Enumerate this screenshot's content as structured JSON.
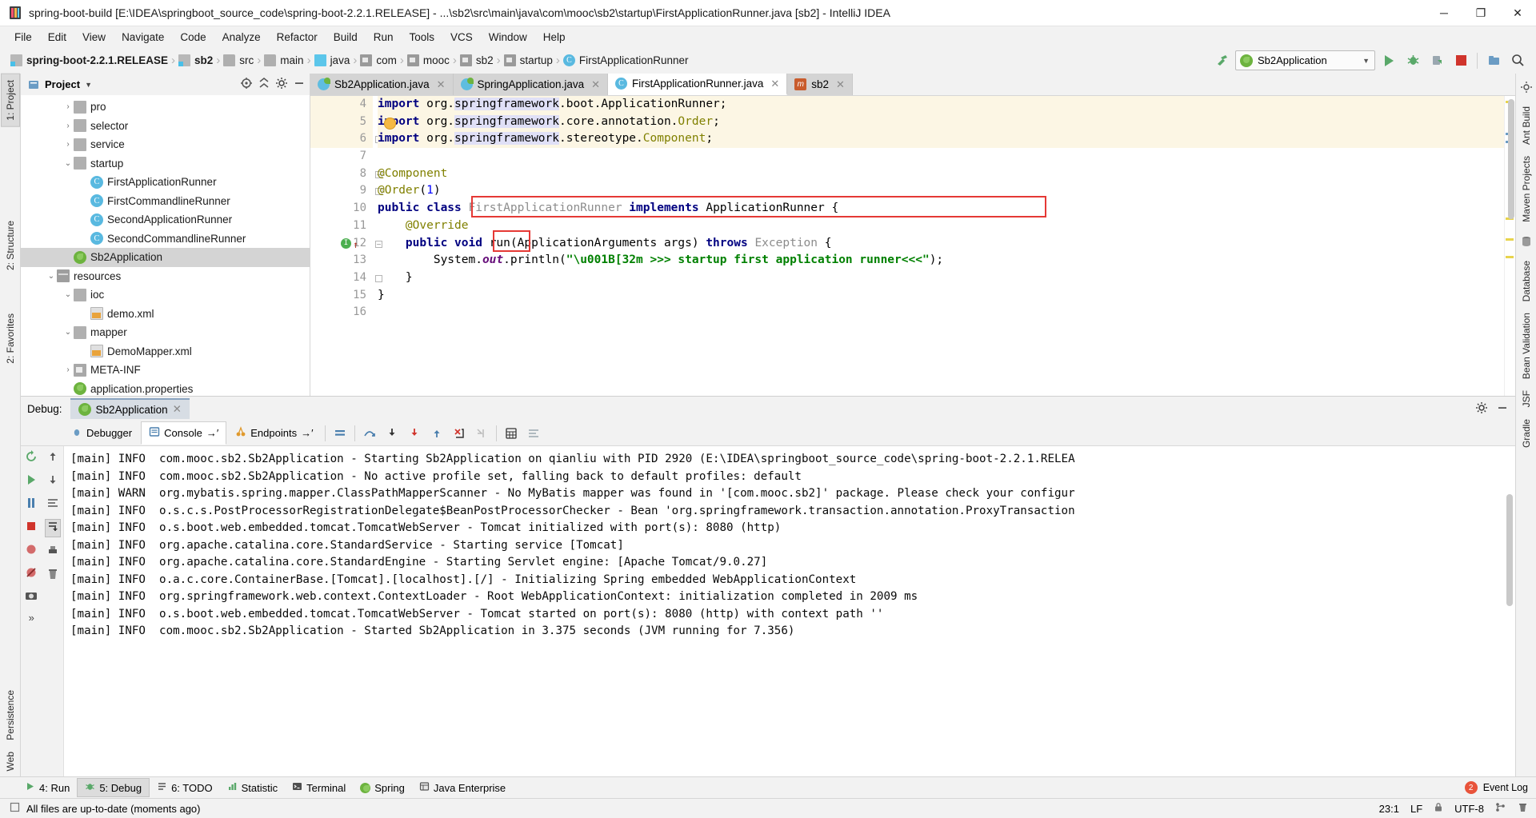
{
  "window": {
    "title": "spring-boot-build [E:\\IDEA\\springboot_source_code\\spring-boot-2.2.1.RELEASE] - ...\\sb2\\src\\main\\java\\com\\mooc\\sb2\\startup\\FirstApplicationRunner.java [sb2] - IntelliJ IDEA",
    "minimize": "─",
    "maximize": "❐",
    "close": "✕"
  },
  "menubar": [
    "File",
    "Edit",
    "View",
    "Navigate",
    "Code",
    "Analyze",
    "Refactor",
    "Build",
    "Run",
    "Tools",
    "VCS",
    "Window",
    "Help"
  ],
  "breadcrumbs": [
    {
      "label": "spring-boot-2.2.1.RELEASE",
      "icon": "module-root-icon",
      "bold": true
    },
    {
      "label": "sb2",
      "icon": "module-root-icon",
      "bold": true
    },
    {
      "label": "src",
      "icon": "folder-icon",
      "bold": false
    },
    {
      "label": "main",
      "icon": "folder-icon",
      "bold": false
    },
    {
      "label": "java",
      "icon": "source-folder-icon",
      "bold": false
    },
    {
      "label": "com",
      "icon": "package-icon",
      "bold": false
    },
    {
      "label": "mooc",
      "icon": "package-icon",
      "bold": false
    },
    {
      "label": "sb2",
      "icon": "package-icon",
      "bold": false
    },
    {
      "label": "startup",
      "icon": "package-icon",
      "bold": false
    },
    {
      "label": "FirstApplicationRunner",
      "icon": "class-icon",
      "bold": false
    }
  ],
  "toolbar": {
    "run_config": "Sb2Application",
    "run_title": "Run",
    "debug_title": "Debug",
    "coverage_title": "Run with Coverage",
    "stop_title": "Stop",
    "search_title": "Search Everywhere"
  },
  "left_rail": {
    "top_tab": "1: Project",
    "tabs": [
      "2: Structure",
      "2: Favorites",
      "Persistence",
      "Web"
    ]
  },
  "right_rail": {
    "tabs": [
      "Ant Build",
      "Maven Projects",
      "Database",
      "Bean Validation",
      "JSF",
      "Gradle"
    ]
  },
  "project_tool": {
    "title": "Project",
    "tree": [
      {
        "indent": 2,
        "arrow": "›",
        "icon": "folder-icon",
        "label": "pro",
        "selected": false
      },
      {
        "indent": 2,
        "arrow": "›",
        "icon": "folder-icon",
        "label": "selector",
        "selected": false
      },
      {
        "indent": 2,
        "arrow": "›",
        "icon": "folder-icon",
        "label": "service",
        "selected": false
      },
      {
        "indent": 2,
        "arrow": "⌄",
        "icon": "folder-icon",
        "label": "startup",
        "selected": false
      },
      {
        "indent": 3,
        "arrow": "",
        "icon": "class-icon",
        "label": "FirstApplicationRunner",
        "selected": false
      },
      {
        "indent": 3,
        "arrow": "",
        "icon": "spring-class-icon",
        "label": "FirstCommandlineRunner",
        "selected": false
      },
      {
        "indent": 3,
        "arrow": "",
        "icon": "spring-class-icon",
        "label": "SecondApplicationRunner",
        "selected": false
      },
      {
        "indent": 3,
        "arrow": "",
        "icon": "spring-class-icon",
        "label": "SecondCommandlineRunner",
        "selected": false
      },
      {
        "indent": 2,
        "arrow": "",
        "icon": "spring-icon",
        "label": "Sb2Application",
        "selected": true
      },
      {
        "indent": 1,
        "arrow": "⌄",
        "icon": "resource-folder-icon",
        "label": "resources",
        "selected": false
      },
      {
        "indent": 2,
        "arrow": "⌄",
        "icon": "folder-icon",
        "label": "ioc",
        "selected": false
      },
      {
        "indent": 3,
        "arrow": "",
        "icon": "xml-icon",
        "label": "demo.xml",
        "selected": false
      },
      {
        "indent": 2,
        "arrow": "⌄",
        "icon": "folder-icon",
        "label": "mapper",
        "selected": false
      },
      {
        "indent": 3,
        "arrow": "",
        "icon": "xml-icon",
        "label": "DemoMapper.xml",
        "selected": false
      },
      {
        "indent": 2,
        "arrow": "›",
        "icon": "package-icon",
        "label": "META-INF",
        "selected": false
      },
      {
        "indent": 2,
        "arrow": "",
        "icon": "spring-icon",
        "label": "application.properties",
        "selected": false
      }
    ]
  },
  "editor_tabs": [
    {
      "label": "Sb2Application.java",
      "icon": "spring-boot-run-icon",
      "active": false,
      "close": "✕"
    },
    {
      "label": "SpringApplication.java",
      "icon": "spring-class-icon",
      "active": false,
      "close": "✕"
    },
    {
      "label": "FirstApplicationRunner.java",
      "icon": "class-icon",
      "active": true,
      "close": "✕"
    },
    {
      "label": "sb2",
      "icon": "maven-icon",
      "active": false,
      "close": "✕"
    }
  ],
  "code": {
    "first_line_number": 4,
    "lines": [
      {
        "n": 4,
        "highlight": true,
        "tokens": [
          {
            "t": "import",
            "c": "kw"
          },
          {
            "t": " org.",
            "c": ""
          },
          {
            "t": "springframework",
            "c": "imp"
          },
          {
            "t": ".boot.ApplicationRunner;",
            "c": ""
          }
        ]
      },
      {
        "n": 5,
        "highlight": true,
        "tokens": [
          {
            "t": "import",
            "c": "kw"
          },
          {
            "t": " org.",
            "c": ""
          },
          {
            "t": "springframework",
            "c": "imp"
          },
          {
            "t": ".core.annotation.",
            "c": ""
          },
          {
            "t": "Order",
            "c": "ann"
          },
          {
            "t": ";",
            "c": ""
          }
        ]
      },
      {
        "n": 6,
        "highlight": true,
        "tokens": [
          {
            "t": "import",
            "c": "kw"
          },
          {
            "t": " org.",
            "c": ""
          },
          {
            "t": "springframework",
            "c": "imp"
          },
          {
            "t": ".stereotype.",
            "c": ""
          },
          {
            "t": "Component",
            "c": "ann"
          },
          {
            "t": ";",
            "c": ""
          }
        ]
      },
      {
        "n": 7,
        "highlight": false,
        "tokens": []
      },
      {
        "n": 8,
        "highlight": false,
        "tokens": [
          {
            "t": "@Component",
            "c": "ann"
          }
        ]
      },
      {
        "n": 9,
        "highlight": false,
        "tokens": [
          {
            "t": "@Order",
            "c": "ann"
          },
          {
            "t": "(",
            "c": ""
          },
          {
            "t": "1",
            "c": "num"
          },
          {
            "t": ")",
            "c": ""
          }
        ]
      },
      {
        "n": 10,
        "highlight": false,
        "tokens": [
          {
            "t": "public class ",
            "c": "kw"
          },
          {
            "t": "FirstApplicationRunner",
            "c": "gray"
          },
          {
            "t": " ",
            "c": ""
          },
          {
            "t": "implements",
            "c": "kw"
          },
          {
            "t": " ApplicationRunner",
            "c": ""
          },
          {
            "t": " {",
            "c": ""
          }
        ]
      },
      {
        "n": 11,
        "highlight": false,
        "tokens": [
          {
            "t": "    @Override",
            "c": "ann"
          }
        ]
      },
      {
        "n": 12,
        "highlight": false,
        "tokens": [
          {
            "t": "    public void ",
            "c": "kw"
          },
          {
            "t": "run",
            "c": ""
          },
          {
            "t": "(ApplicationArguments args) ",
            "c": ""
          },
          {
            "t": "throws",
            "c": "kw"
          },
          {
            "t": " ",
            "c": ""
          },
          {
            "t": "Exception",
            "c": "gray"
          },
          {
            "t": " {",
            "c": ""
          }
        ]
      },
      {
        "n": 13,
        "highlight": false,
        "tokens": [
          {
            "t": "        System.",
            "c": ""
          },
          {
            "t": "out",
            "c": "fld"
          },
          {
            "t": ".println(",
            "c": ""
          },
          {
            "t": "\"\\u001B[32m >>> startup first application runner<<<\"",
            "c": "str"
          },
          {
            "t": ");",
            "c": ""
          }
        ]
      },
      {
        "n": 14,
        "highlight": false,
        "tokens": [
          {
            "t": "    }",
            "c": ""
          }
        ]
      },
      {
        "n": 15,
        "highlight": false,
        "tokens": [
          {
            "t": "}",
            "c": ""
          }
        ]
      },
      {
        "n": 16,
        "highlight": false,
        "tokens": []
      }
    ],
    "red_box_class": "FirstApplicationRunner implements ApplicationRunner",
    "red_box_method": "run(",
    "gutter_line12_badge": "I"
  },
  "debug": {
    "label": "Debug:",
    "session_tab": "Sb2Application",
    "session_close": "✕",
    "tabs": [
      {
        "label": "Debugger",
        "icon": "debugger-icon",
        "selected": false
      },
      {
        "label": "Console",
        "icon": "console-icon",
        "selected": true,
        "suffix": "→′"
      },
      {
        "label": "Endpoints",
        "icon": "endpoints-icon",
        "selected": false,
        "suffix": "→′"
      }
    ],
    "settings_title": "Settings",
    "hide_title": "Hide"
  },
  "console": {
    "lines": [
      "[main] INFO  com.mooc.sb2.Sb2Application - Starting Sb2Application on qianliu with PID 2920 (E:\\IDEA\\springboot_source_code\\spring-boot-2.2.1.RELEA",
      "[main] INFO  com.mooc.sb2.Sb2Application - No active profile set, falling back to default profiles: default",
      "[main] WARN  org.mybatis.spring.mapper.ClassPathMapperScanner - No MyBatis mapper was found in '[com.mooc.sb2]' package. Please check your configur",
      "[main] INFO  o.s.c.s.PostProcessorRegistrationDelegate$BeanPostProcessorChecker - Bean 'org.springframework.transaction.annotation.ProxyTransaction",
      "[main] INFO  o.s.boot.web.embedded.tomcat.TomcatWebServer - Tomcat initialized with port(s): 8080 (http)",
      "[main] INFO  org.apache.catalina.core.StandardService - Starting service [Tomcat]",
      "[main] INFO  org.apache.catalina.core.StandardEngine - Starting Servlet engine: [Apache Tomcat/9.0.27]",
      "[main] INFO  o.a.c.core.ContainerBase.[Tomcat].[localhost].[/] - Initializing Spring embedded WebApplicationContext",
      "[main] INFO  org.springframework.web.context.ContextLoader - Root WebApplicationContext: initialization completed in 2009 ms",
      "[main] INFO  o.s.boot.web.embedded.tomcat.TomcatWebServer - Tomcat started on port(s): 8080 (http) with context path ''",
      "[main] INFO  com.mooc.sb2.Sb2Application - Started Sb2Application in 3.375 seconds (JVM running for 7.356)"
    ]
  },
  "bottom_tools": [
    {
      "label": "4: Run",
      "icon": "run-icon",
      "selected": false
    },
    {
      "label": "5: Debug",
      "icon": "debug-icon",
      "selected": true
    },
    {
      "label": "6: TODO",
      "icon": "todo-icon",
      "selected": false
    },
    {
      "label": "Statistic",
      "icon": "statistic-icon",
      "selected": false
    },
    {
      "label": "Terminal",
      "icon": "terminal-icon",
      "selected": false
    },
    {
      "label": "Spring",
      "icon": "spring-icon",
      "selected": false
    },
    {
      "label": "Java Enterprise",
      "icon": "java-enterprise-icon",
      "selected": false
    }
  ],
  "event_log": {
    "label": "Event Log",
    "count": "2"
  },
  "statusbar": {
    "message": "All files are up-to-date (moments ago)",
    "caret": "23:1",
    "line_sep": "LF",
    "encoding": "UTF-8",
    "branch_icon": "git-branch-icon",
    "lock_icon": "lock-icon"
  }
}
